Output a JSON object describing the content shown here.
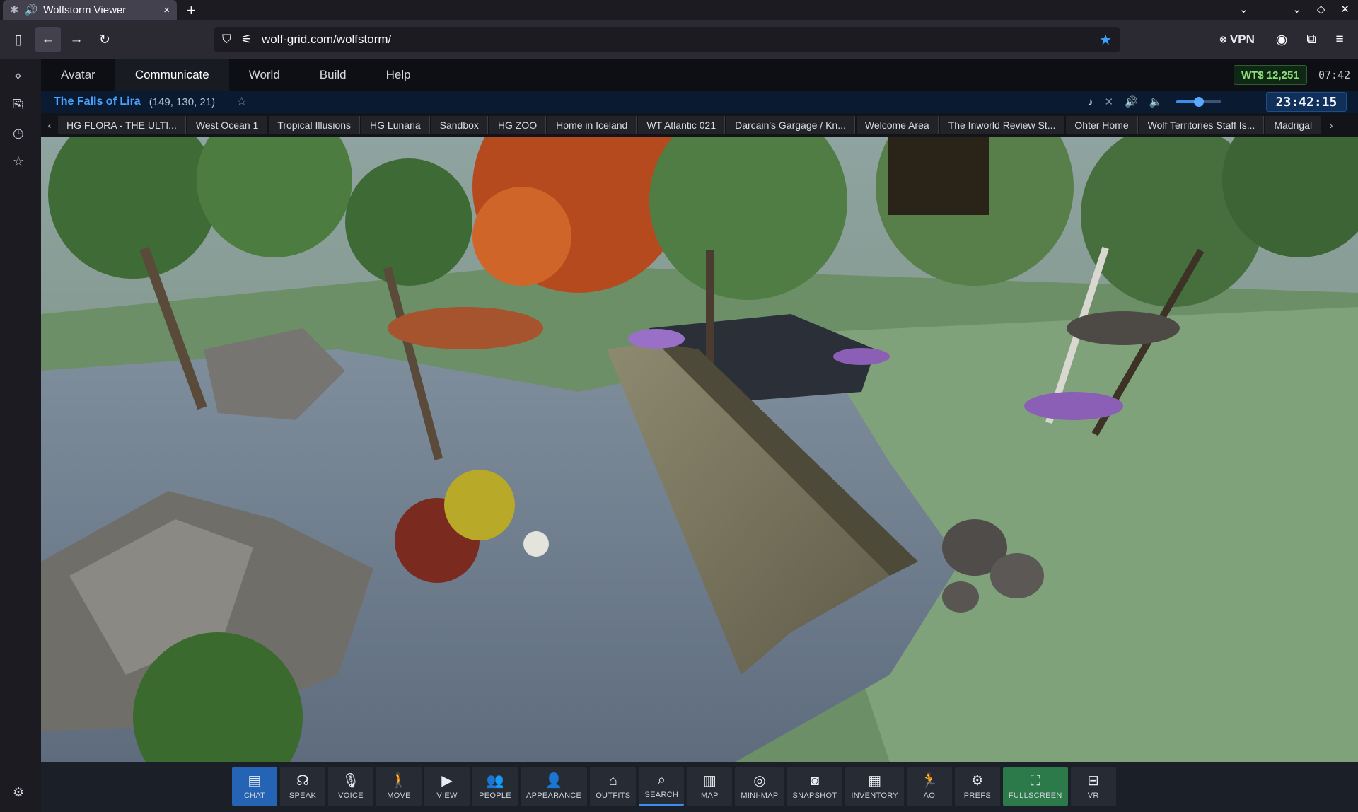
{
  "browser": {
    "tab_title": "Wolfstorm Viewer",
    "tab_close": "×",
    "new_tab": "+",
    "url": "wolf-grid.com/wolfstorm/",
    "vpn_label": "VPN",
    "accent": "#3ba3ff"
  },
  "menu": {
    "items": [
      "Avatar",
      "Communicate",
      "World",
      "Build",
      "Help"
    ],
    "active": "Communicate"
  },
  "status": {
    "balance": "WT$ 12,251",
    "time_small": "07:42",
    "region": "The Falls of Lira",
    "coords": "(149, 130, 21)",
    "clock": "23:42:15",
    "volume_fraction": 0.5
  },
  "bookmarks": [
    "HG FLORA - THE ULTI...",
    "West Ocean 1",
    "Tropical Illusions",
    "HG Lunaria",
    "Sandbox",
    "HG ZOO",
    "Home in Iceland",
    "WT Atlantic 021",
    "Darcain's Gargage / Kn...",
    "Welcome Area",
    "The Inworld Review St...",
    "Ohter Home",
    "Wolf Territories Staff Is...",
    "Madrigal"
  ],
  "toolbar": {
    "chat": "CHAT",
    "speak": "SPEAK",
    "voice": "VOICE",
    "move": "MOVE",
    "view": "VIEW",
    "people": "PEOPLE",
    "appearance": "APPEARANCE",
    "outfits": "OUTFITS",
    "search": "SEARCH",
    "map": "MAP",
    "minimap": "MINI-MAP",
    "snapshot": "SNAPSHOT",
    "inventory": "INVENTORY",
    "ao": "AO",
    "prefs": "PREFS",
    "fullscreen": "FULLSCREEN",
    "vr": "VR"
  }
}
